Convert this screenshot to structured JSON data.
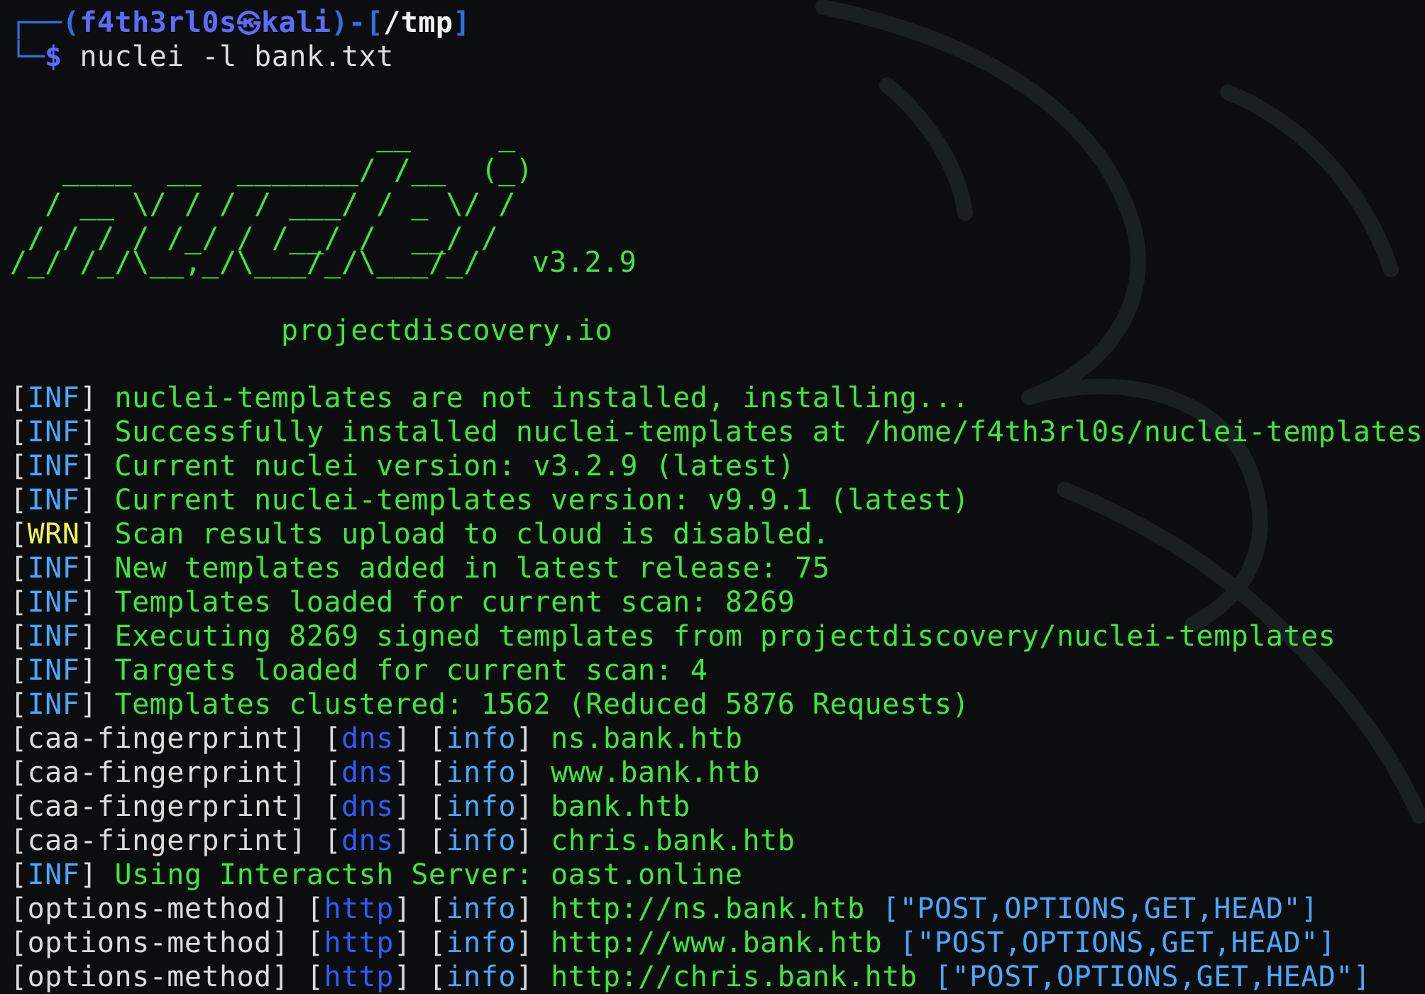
{
  "prompt": {
    "user": "f4th3rl0s",
    "host": "kali",
    "cwd": "/tmp",
    "command": "nuclei -l bank.txt"
  },
  "banner": {
    "ascii": [
      "                     __     _",
      "   ____  __  _______/ /__  (_)",
      "  / __ \\/ / / / ___/ / _ \\/ /",
      " / / / / /_/ / /__/ /  __/ /",
      "/_/ /_/\\__,_/\\___/_/\\___/_/"
    ],
    "version": "v3.2.9",
    "site": "projectdiscovery.io"
  },
  "log": [
    {
      "tag": "INF",
      "msg": "nuclei-templates are not installed, installing..."
    },
    {
      "tag": "INF",
      "msg": "Successfully installed nuclei-templates at /home/f4th3rl0s/nuclei-templates"
    },
    {
      "tag": "INF",
      "msg": "Current nuclei version: v3.2.9 (latest)"
    },
    {
      "tag": "INF",
      "msg": "Current nuclei-templates version: v9.9.1 (latest)"
    },
    {
      "tag": "WRN",
      "msg": "Scan results upload to cloud is disabled."
    },
    {
      "tag": "INF",
      "msg": "New templates added in latest release: 75"
    },
    {
      "tag": "INF",
      "msg": "Templates loaded for current scan: 8269"
    },
    {
      "tag": "INF",
      "msg": "Executing 8269 signed templates from projectdiscovery/nuclei-templates"
    },
    {
      "tag": "INF",
      "msg": "Targets loaded for current scan: 4"
    },
    {
      "tag": "INF",
      "msg": "Templates clustered: 1562 (Reduced 5876 Requests)"
    }
  ],
  "findings_dns": [
    {
      "template": "caa-fingerprint",
      "protocol": "dns",
      "severity": "info",
      "host": "ns.bank.htb"
    },
    {
      "template": "caa-fingerprint",
      "protocol": "dns",
      "severity": "info",
      "host": "www.bank.htb"
    },
    {
      "template": "caa-fingerprint",
      "protocol": "dns",
      "severity": "info",
      "host": "bank.htb"
    },
    {
      "template": "caa-fingerprint",
      "protocol": "dns",
      "severity": "info",
      "host": "chris.bank.htb"
    }
  ],
  "interactsh": {
    "tag": "INF",
    "msg": "Using Interactsh Server: oast.online"
  },
  "findings_http": [
    {
      "template": "options-method",
      "protocol": "http",
      "severity": "info",
      "host": "http://ns.bank.htb",
      "extra": "[\"POST,OPTIONS,GET,HEAD\"]"
    },
    {
      "template": "options-method",
      "protocol": "http",
      "severity": "info",
      "host": "http://www.bank.htb",
      "extra": "[\"POST,OPTIONS,GET,HEAD\"]"
    },
    {
      "template": "options-method",
      "protocol": "http",
      "severity": "info",
      "host": "http://chris.bank.htb",
      "extra": "[\"POST,OPTIONS,GET,HEAD\"]"
    }
  ],
  "colors": {
    "background": "#0b0d0e",
    "green": "#3ee83a",
    "info_blue": "#4aa8ff",
    "warn_yellow": "#f4f34e",
    "prompt_blue": "#5c6cff"
  }
}
